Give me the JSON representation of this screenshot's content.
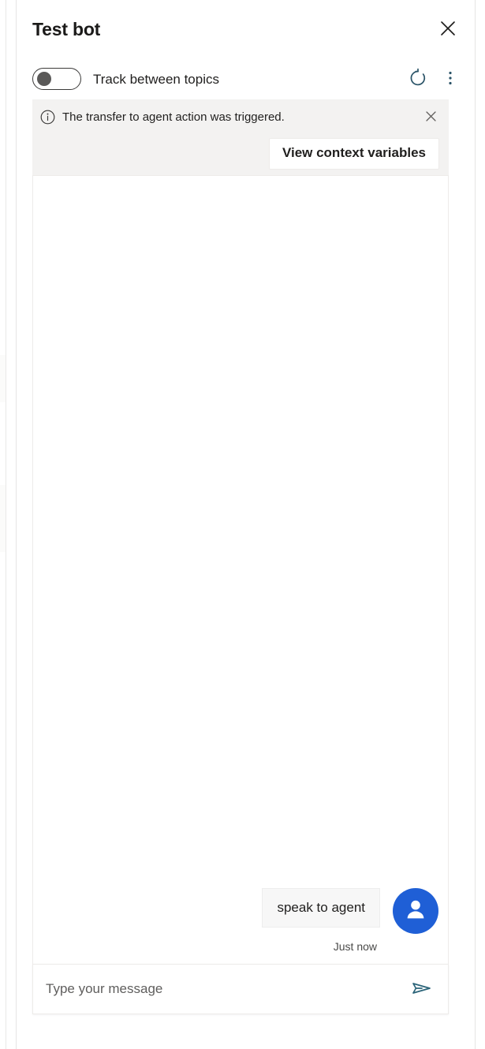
{
  "window": {
    "title": "Test bot",
    "close_icon": "close-icon"
  },
  "toolbar": {
    "toggle": {
      "label": "Track between topics",
      "state": "off",
      "icon": "toggle-switch-icon"
    },
    "refresh_icon": "refresh-icon",
    "more_options_icon": "more-vertical-icon"
  },
  "notification": {
    "info_icon": "info-circle-icon",
    "message": "The transfer to agent action was triggered.",
    "dismiss_icon": "close-icon",
    "action_label": "View context variables",
    "background": "#f3f2f1"
  },
  "transcript": {
    "messages": [
      {
        "text": "speak to agent",
        "sender": "user",
        "timestamp": "Just now",
        "avatar_icon": "person-icon"
      }
    ]
  },
  "composer": {
    "placeholder": "Type your message",
    "value": "",
    "send_icon": "send-icon"
  },
  "colors": {
    "avatar_blue": "#1f5fd6",
    "accent_teal": "#2b6479",
    "text_primary": "#201f1e",
    "notification_bg": "#f3f2f1",
    "bubble_bg": "#f7f7f7"
  }
}
